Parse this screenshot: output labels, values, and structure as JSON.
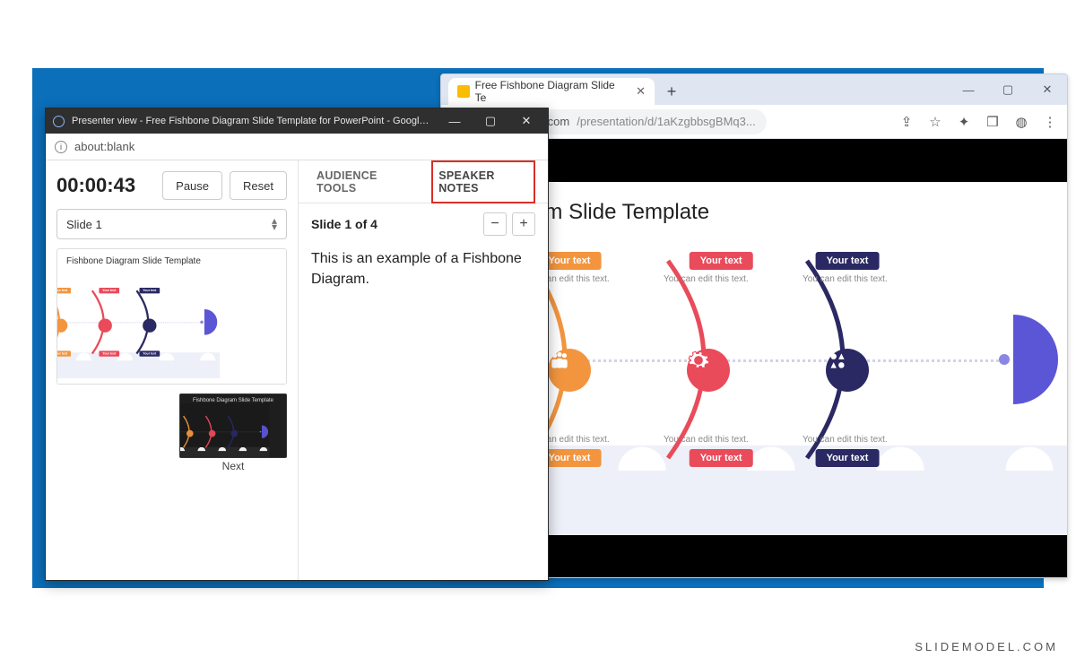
{
  "watermark": "SLIDEMODEL.COM",
  "chrome": {
    "tab_title": "Free Fishbone Diagram Slide Te",
    "url_host": "docs.google.com",
    "url_path": "/presentation/d/1aKzgbbsgBMq3...",
    "win_buttons": {
      "min": "—",
      "max": "▢",
      "close": "✕"
    }
  },
  "slide": {
    "title_fragment": "one Diagram Slide Template",
    "your_text": "Your text",
    "edit_text": "You can edit this text.",
    "thumb_title": "Fishbone Diagram Slide Template",
    "next_thumb_title": "Fishbone Diagram Slide Template"
  },
  "presenter": {
    "window_title": "Presenter view - Free Fishbone Diagram Slide Template for PowerPoint - Google Slides - G...",
    "address": "about:blank",
    "timer": "00:00:43",
    "pause": "Pause",
    "reset": "Reset",
    "slide_selector": "Slide 1",
    "next_label": "Next",
    "tabs": {
      "audience": "AUDIENCE TOOLS",
      "speaker": "SPEAKER NOTES"
    },
    "notes_title": "Slide 1 of 4",
    "notes_body": "This is an example of a Fishbone Diagram.",
    "win_buttons": {
      "min": "—",
      "max": "▢",
      "close": "✕"
    }
  }
}
